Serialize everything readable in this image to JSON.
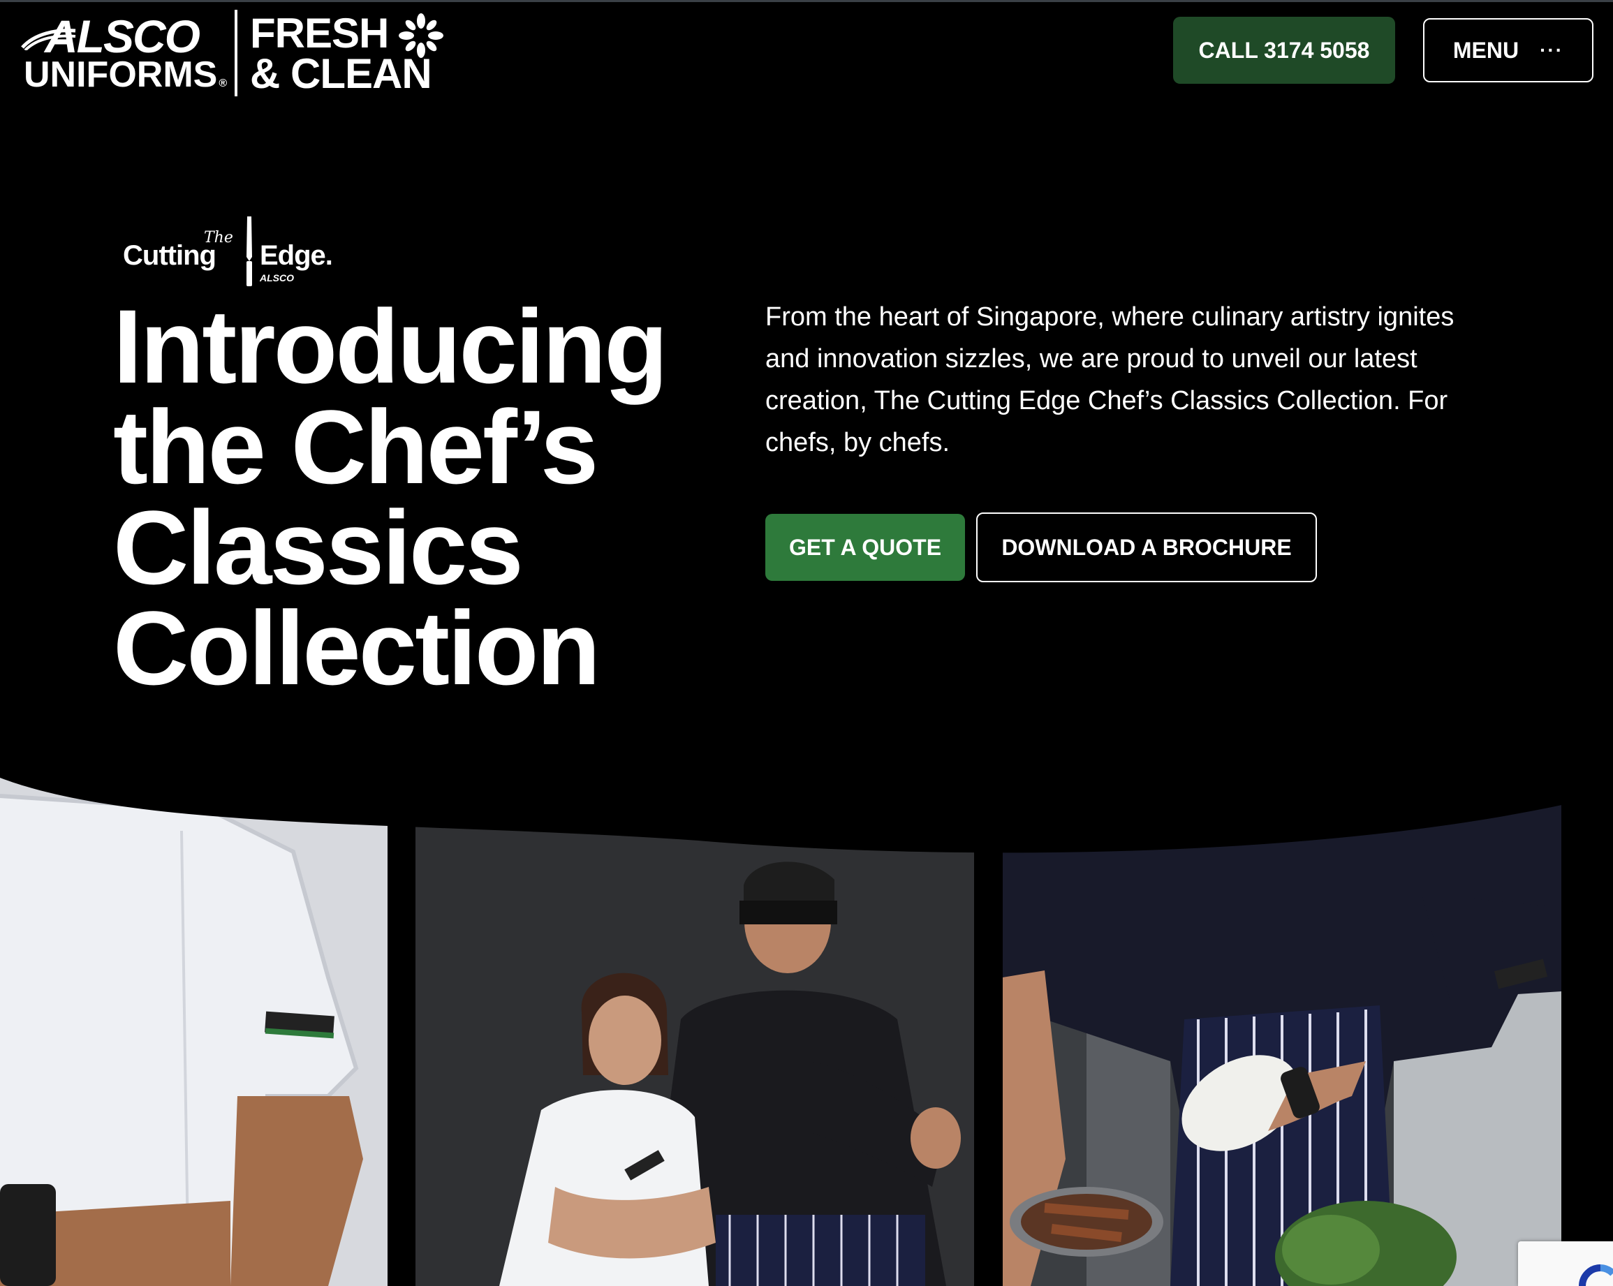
{
  "header": {
    "brand_alsco": "ALSCO",
    "brand_uniforms": "UNIFORMS",
    "brand_reg": "®",
    "brand_fresh_line1": "FRESH",
    "brand_fresh_line2": "& CLEAN",
    "call_label": "CALL 3174 5058",
    "menu_label": "MENU",
    "menu_icon": "more-dots-icon",
    "dots": "···"
  },
  "hero": {
    "logo": {
      "the": "The",
      "cutting": "Cutting",
      "edge": "Edge.",
      "alsco": "ALSCO"
    },
    "title": "Introducing the Chef’s Classics Collection",
    "description": "From the heart of Singapore, where culinary artistry ignites and innovation sizzles, we are proud to unveil our latest creation, The Cutting Edge Chef’s Classics Collection. For chefs, by chefs.",
    "quote_button": "GET A QUOTE",
    "brochure_button": "DOWNLOAD A BROCHURE"
  },
  "colors": {
    "background": "#000000",
    "call_button": "#1f4a27",
    "quote_button": "#2e7a3b",
    "text": "#ffffff"
  },
  "photos": [
    {
      "name": "chef-white-jacket-sleeve"
    },
    {
      "name": "two-chefs-portrait"
    },
    {
      "name": "chef-cooking-apron"
    }
  ]
}
